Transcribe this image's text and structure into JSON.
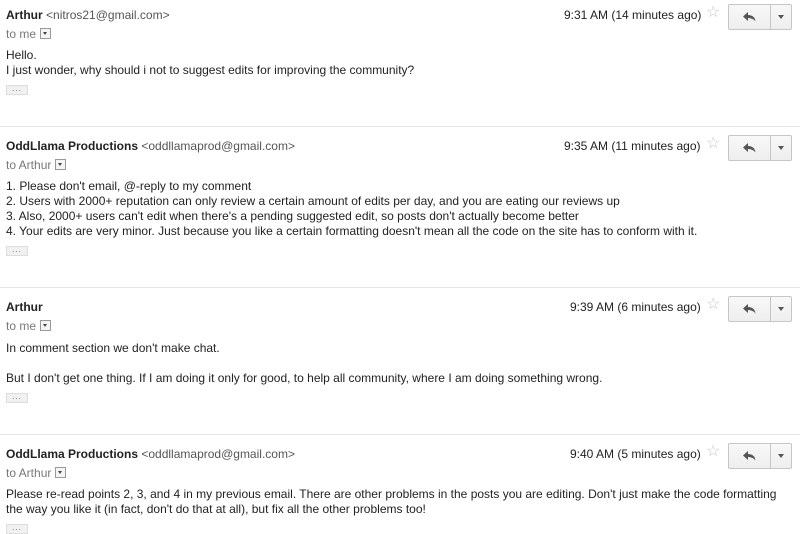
{
  "messages": [
    {
      "sender_name": "Arthur",
      "sender_email": "<nitros21@gmail.com>",
      "recipient": "to me",
      "timestamp": "9:31 AM (14 minutes ago)",
      "paragraphs": [
        "Hello.",
        "I just wonder, why should i not to suggest edits for improving the community?"
      ],
      "trim_label": "..."
    },
    {
      "sender_name": "OddLlama Productions",
      "sender_email": "<oddllamaprod@gmail.com>",
      "recipient": "to Arthur",
      "timestamp": "9:35 AM (11 minutes ago)",
      "paragraphs": [
        "1. Please don't email, @-reply to my comment",
        "2. Users with 2000+ reputation can only review a certain amount of edits per day, and you are eating our reviews up",
        "3. Also, 2000+ users can't edit when there's a pending suggested edit, so posts don't actually become better",
        "4. Your edits are very minor. Just because you like a certain formatting doesn't mean all the code on the site has to conform with it."
      ],
      "trim_label": "..."
    },
    {
      "sender_name": "Arthur",
      "sender_email": "",
      "recipient": "to me",
      "timestamp": "9:39 AM (6 minutes ago)",
      "paragraphs": [
        "In comment section we don't make chat.",
        "But I don't get one thing. If I am doing it only for good, to help all community, where I am doing something wrong."
      ],
      "trim_label": "..."
    },
    {
      "sender_name": "OddLlama Productions",
      "sender_email": "<oddllamaprod@gmail.com>",
      "recipient": "to Arthur",
      "timestamp": "9:40 AM (5 minutes ago)",
      "paragraphs": [
        "Please re-read points 2, 3, and 4 in my previous email. There are other problems in the posts you are editing. Don't just make the code formatting the way you like it (in fact, don't do that at all), but fix all the other problems too!"
      ],
      "trim_label": "..."
    }
  ],
  "icons": {
    "star": "star-outline-icon",
    "reply": "reply-arrow-icon",
    "more": "dropdown-caret-icon",
    "details": "show-details-icon"
  },
  "colors": {
    "separator": "#e5e5e5",
    "button_border": "#c6c6c6",
    "star": "#c8c8c8"
  }
}
